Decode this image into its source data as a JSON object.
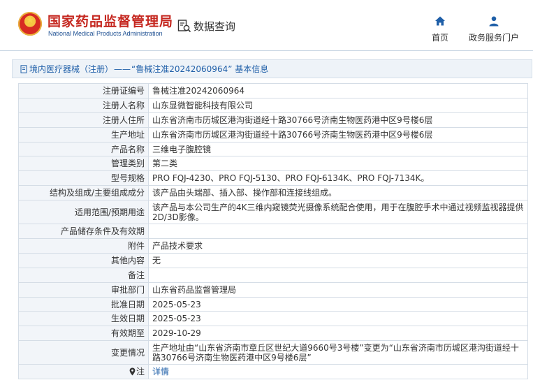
{
  "header": {
    "logo_cn": "国家药品监督管理局",
    "logo_en": "National Medical Products Administration",
    "query_label": "数据查询",
    "nav": [
      {
        "label": "首页",
        "icon": "home-icon"
      },
      {
        "label": "政务服务门户",
        "icon": "user-icon"
      }
    ]
  },
  "breadcrumb": {
    "link": "境内医疗器械（注册）",
    "separator": "——",
    "current": "“鲁械注准20242060964” 基本信息"
  },
  "fields": [
    {
      "label": "注册证编号",
      "value": "鲁械注准20242060964"
    },
    {
      "label": "注册人名称",
      "value": "山东显微智能科技有限公司"
    },
    {
      "label": "注册人住所",
      "value": "山东省济南市历城区港沟街道经十路30766号济南生物医药港中区9号楼6层"
    },
    {
      "label": "生产地址",
      "value": "山东省济南市历城区港沟街道经十路30766号济南生物医药港中区9号楼6层"
    },
    {
      "label": "产品名称",
      "value": "三维电子腹腔镜"
    },
    {
      "label": "管理类别",
      "value": "第二类"
    },
    {
      "label": "型号规格",
      "value": "PRO FQJ-4230、PRO FQJ-5130、PRO FQJ-6134K、PRO FQJ-7134K。"
    },
    {
      "label": "结构及组成/主要组成成分",
      "value": "该产品由头端部、插入部、操作部和连接线组成。"
    },
    {
      "label": "适用范围/预期用途",
      "value": "该产品与本公司生产的4K三维内窥镜荧光摄像系统配合使用，用于在腹腔手术中通过视频监视器提供2D/3D影像。"
    },
    {
      "label": "产品储存条件及有效期",
      "value": ""
    },
    {
      "label": "附件",
      "value": "产品技术要求"
    },
    {
      "label": "其他内容",
      "value": "无"
    },
    {
      "label": "备注",
      "value": ""
    },
    {
      "label": "审批部门",
      "value": "山东省药品监督管理局"
    },
    {
      "label": "批准日期",
      "value": "2025-05-23"
    },
    {
      "label": "生效日期",
      "value": "2025-05-23"
    },
    {
      "label": "有效期至",
      "value": "2029-10-29"
    },
    {
      "label": "变更情况",
      "value": "生产地址由“山东省济南市章丘区世纪大道9660号3号楼”变更为“山东省济南市历城区港沟街道经十路30766号济南生物医药港中区9号楼6层”"
    }
  ],
  "last_row": {
    "label": "注",
    "link": "详情"
  }
}
